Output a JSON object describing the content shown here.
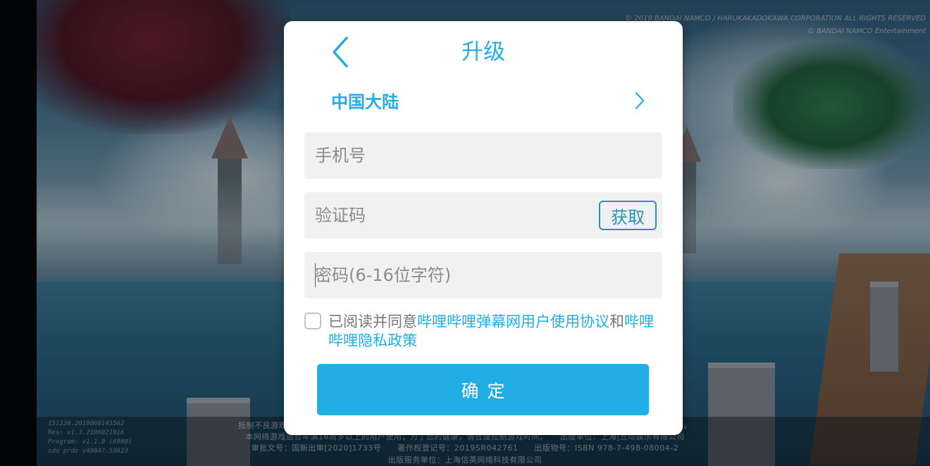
{
  "dialog": {
    "title": "升级",
    "region": "中国大陆",
    "phone_placeholder": "手机号",
    "code_placeholder": "验证码",
    "get_code_label": "获取",
    "password_placeholder": "密码(6-16位字符)",
    "agreement": {
      "prefix": "已阅读并同意",
      "user_agreement_link": "哔哩哔哩弹幕网用户使用协议",
      "conjunction": "和",
      "privacy_link": "哔哩哔哩隐私政策",
      "checked": false
    },
    "confirm_label": "确定"
  },
  "background": {
    "footer_lines": [
      "抵制不良游戏，拒绝盗版游戏。注意自我保护，谨防受骗上当。适度游戏益脑，沉迷游戏伤身。合理安排时间，享受健康生活。",
      "本网络游戏适合年满16周岁以上的用户使用；为了您的健康，请合理控制游戏时间。　　出版单位：上海|互动娱乐有限公司",
      "审批文号：国新出审[2020]1733号　　著作权登记号：2019SR042761　　出版物号：ISBN 978-7-498-08004-2",
      "出版服务单位：上海信英网络科技有限公司"
    ],
    "version_lines": [
      "151220.2019060145562",
      "Res: v1.3.2106021916",
      "Program: v1.1.0 (6980)",
      "sdo prdz v49047.53623"
    ],
    "copyright_lines": [
      "© 2019 BANDAI NAMCO / HARUKAKADOKAWA CORPORATION ALL RIGHTS RESERVED",
      "© BANDAI NAMCO Entertainment"
    ]
  },
  "colors": {
    "accent": "#23ade5",
    "field_bg": "#f1f1f1",
    "button_border": "#2593b6"
  },
  "icons": {
    "back": "chevron-left-icon",
    "region": "chevron-right-icon"
  }
}
